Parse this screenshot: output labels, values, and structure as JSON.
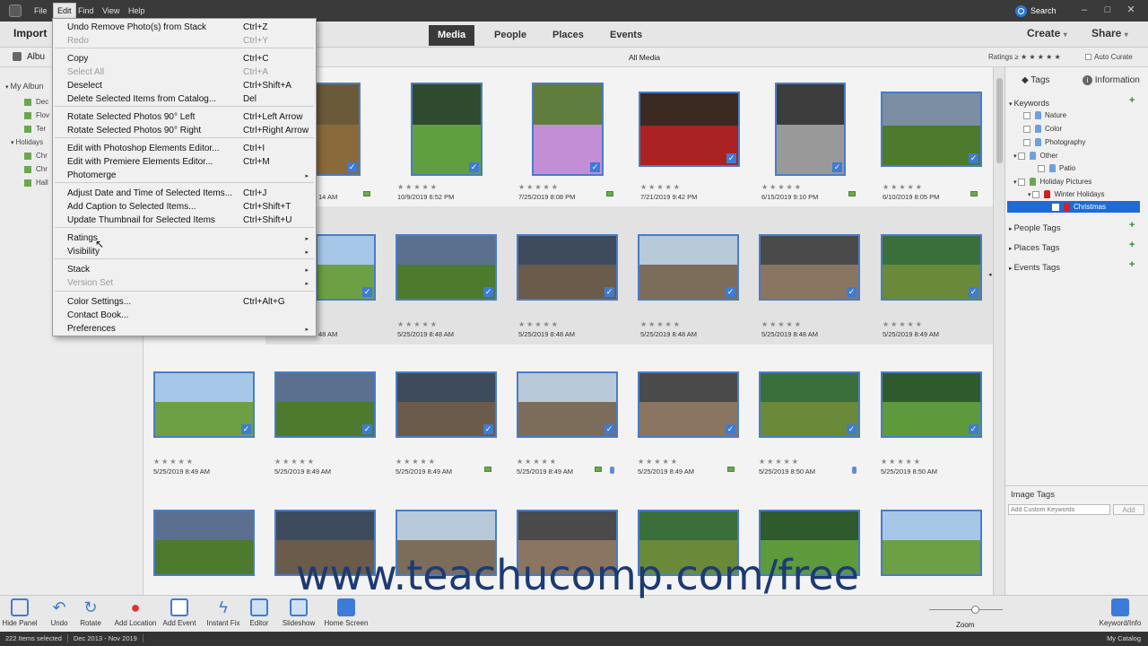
{
  "menubar": {
    "items": [
      "File",
      "Edit",
      "Find",
      "View",
      "Help"
    ],
    "search_label": "Search"
  },
  "header": {
    "import_label": "Import",
    "tabs": [
      "Media",
      "People",
      "Places",
      "Events"
    ],
    "create_label": "Create",
    "share_label": "Share"
  },
  "subbar": {
    "albums_label": "Albu",
    "view_label": "All Media",
    "ratings_label": "Ratings ≥ ★ ★ ★ ★ ★",
    "auto_curate_label": "Auto Curate"
  },
  "left_panel": {
    "my_albums": "My Albun",
    "items": [
      "Dec",
      "Flov",
      "Ter",
      "Holidays",
      "Chr",
      "Chr",
      "Hall"
    ]
  },
  "edit_menu": {
    "items": [
      {
        "label": "Undo Remove Photo(s) from Stack",
        "shortcut": "Ctrl+Z",
        "disabled": false
      },
      {
        "label": "Redo",
        "shortcut": "Ctrl+Y",
        "disabled": true
      },
      {
        "label": "Copy",
        "shortcut": "Ctrl+C",
        "disabled": false
      },
      {
        "label": "Select All",
        "shortcut": "Ctrl+A",
        "disabled": true
      },
      {
        "label": "Deselect",
        "shortcut": "Ctrl+Shift+A",
        "disabled": false
      },
      {
        "label": "Delete Selected Items from Catalog...",
        "shortcut": "Del",
        "disabled": false
      },
      {
        "label": "Rotate Selected Photos 90° Left",
        "shortcut": "Ctrl+Left Arrow",
        "disabled": false
      },
      {
        "label": "Rotate Selected Photos 90° Right",
        "shortcut": "Ctrl+Right Arrow",
        "disabled": false
      },
      {
        "label": "Edit with Photoshop Elements Editor...",
        "shortcut": "Ctrl+I",
        "disabled": false
      },
      {
        "label": "Edit with Premiere Elements Editor...",
        "shortcut": "Ctrl+M",
        "disabled": false
      },
      {
        "label": "Photomerge",
        "shortcut": "",
        "disabled": false
      },
      {
        "label": "Adjust Date and Time of Selected Items...",
        "shortcut": "Ctrl+J",
        "disabled": false
      },
      {
        "label": "Add Caption to Selected Items...",
        "shortcut": "Ctrl+Shift+T",
        "disabled": false
      },
      {
        "label": "Update Thumbnail for Selected Items",
        "shortcut": "Ctrl+Shift+U",
        "disabled": false
      },
      {
        "label": "Ratings",
        "shortcut": "",
        "disabled": false
      },
      {
        "label": "Visibility",
        "shortcut": "",
        "disabled": false
      },
      {
        "label": "Stack",
        "shortcut": "",
        "disabled": false
      },
      {
        "label": "Version Set",
        "shortcut": "",
        "disabled": true
      },
      {
        "label": "Color Settings...",
        "shortcut": "Ctrl+Alt+G",
        "disabled": false
      },
      {
        "label": "Contact Book...",
        "shortcut": "",
        "disabled": false
      },
      {
        "label": "Preferences",
        "shortcut": "",
        "disabled": false
      }
    ]
  },
  "photos": {
    "rows": [
      [
        "14 AM",
        "10/9/2019 6:52 PM",
        "7/25/2019 8:08 PM",
        "7/21/2019 9:42 PM",
        "6/15/2019 9:10 PM",
        "6/10/2019 8:05 PM"
      ],
      [
        "",
        "5/25/2019 8:48 AM",
        "5/25/2019 8:48 AM",
        "5/25/2019 8:48 AM",
        "5/25/2019 8:48 AM",
        "5/25/2019 8:49 AM"
      ],
      [
        "5/25/2019 8:49 AM",
        "5/25/2019 8:49 AM",
        "5/25/2019 8:49 AM",
        "5/25/2019 8:49 AM",
        "5/25/2019 8:49 AM",
        "5/25/2019 8:50 AM",
        "5/25/2019 8:50 AM"
      ]
    ],
    "partial_row2_date": "48 AM"
  },
  "right_panel": {
    "tags_tab": "Tags",
    "info_tab": "Information",
    "keywords_label": "Keywords",
    "keywords": [
      "Nature",
      "Color",
      "Photography",
      "Other",
      "Patio",
      "Holiday Pictures",
      "Winter Holidays",
      "Christmas"
    ],
    "people_tags": "People Tags",
    "places_tags": "Places Tags",
    "events_tags": "Events Tags",
    "image_tags": "Image Tags",
    "add_placeholder": "Add Custom Keywords",
    "add_button": "Add"
  },
  "bottom_tools": [
    "Hide Panel",
    "Undo",
    "Rotate",
    "Add Location",
    "Add Event",
    "Instant Fix",
    "Editor",
    "Slideshow",
    "Home Screen"
  ],
  "zoom_label": "Zoom",
  "keyword_info_label": "Keyword/Info",
  "status": {
    "items_selected": "222 Items selected",
    "date_range": "Dec 2013 - Nov 2019",
    "catalog": "My Catalog"
  },
  "watermark": "www.teachucomp.com/free"
}
